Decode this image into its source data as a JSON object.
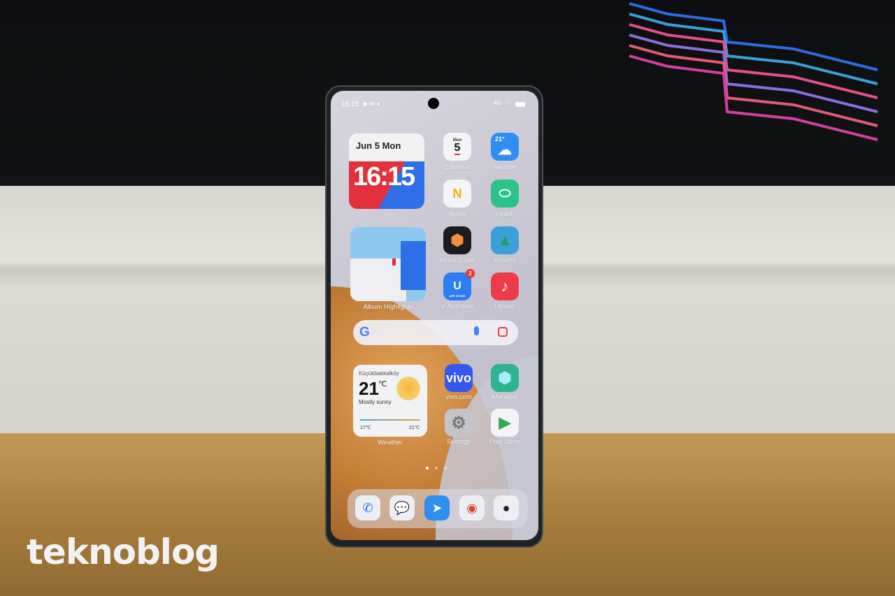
{
  "status_bar": {
    "time": "16:15",
    "network": "4G",
    "battery_icon": "battery-icon",
    "wifi_icon": "wifi-icon"
  },
  "widgets": {
    "time": {
      "date": "Jun 5 Mon",
      "clock": "16:15",
      "label": "Time"
    },
    "album": {
      "label": "Album Highlights"
    },
    "weather": {
      "location": "Küçükbakkalköy",
      "temp": "21",
      "unit": "℃",
      "condition": "Mostly sunny",
      "low": "17℃",
      "high": "21℃",
      "label": "Weather"
    }
  },
  "apps": [
    {
      "label": "Calendar",
      "day": "Mon",
      "date": "5",
      "bg": "#f4f4f6"
    },
    {
      "label": "Weather",
      "temp": "21°",
      "bg": "#2f8ef0"
    },
    {
      "label": "Notes",
      "glyph": "N",
      "bg": "#f4f4f6"
    },
    {
      "label": "Health",
      "bg": "#2cc28a"
    },
    {
      "label": "Mood Cube",
      "bg": "#1c1c1e"
    },
    {
      "label": "Albums",
      "bg": "#3aa0d8"
    },
    {
      "label": "V-Appstore",
      "badge": "2",
      "sub": "APP STORE",
      "bg": "#2d7cf0"
    },
    {
      "label": "i Music",
      "bg": "#ee3b4a"
    },
    {
      "label": "vivo.com",
      "glyph": "vivo",
      "bg": "#3457f0"
    },
    {
      "label": "iManager",
      "bg": "#2fb48f"
    },
    {
      "label": "Settings",
      "bg": "#c3c3cc"
    },
    {
      "label": "Play Store",
      "bg": "#f4f4f6"
    }
  ],
  "search": {
    "google_icon": "G",
    "mic_icon": "mic-icon",
    "lens_icon": "lens-icon"
  },
  "page_indicator": {
    "pages": 3,
    "current": 1
  },
  "dock": [
    {
      "name": "phone",
      "glyph": "✆"
    },
    {
      "name": "messages",
      "glyph": "💬"
    },
    {
      "name": "spark",
      "glyph": "➤"
    },
    {
      "name": "chrome",
      "glyph": "◉"
    },
    {
      "name": "camera",
      "glyph": "●"
    }
  ],
  "watermark": "teknoblog"
}
